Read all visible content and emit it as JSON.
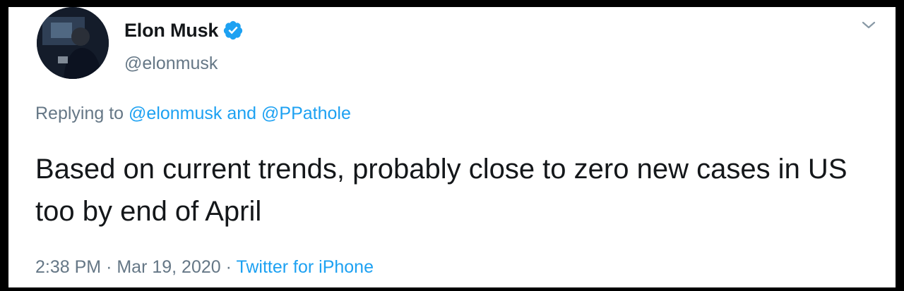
{
  "author": {
    "display_name": "Elon Musk",
    "handle": "@elonmusk",
    "verified": true
  },
  "reply_context": {
    "prefix": "Replying to",
    "mention_1": "@elonmusk",
    "conjunction": "and",
    "mention_2": "@PPathole"
  },
  "tweet": {
    "text": "Based on current trends, probably close to zero new cases in US too by end of April"
  },
  "meta": {
    "time": "2:38 PM",
    "separator": "·",
    "date": "Mar 19, 2020",
    "source": "Twitter for iPhone"
  },
  "icons": {
    "verified": "verified-badge-icon",
    "menu": "chevron-down-icon"
  },
  "colors": {
    "link": "#1da1f2",
    "secondary_text": "#657786",
    "primary_text": "#14171a",
    "frame": "#000000"
  }
}
